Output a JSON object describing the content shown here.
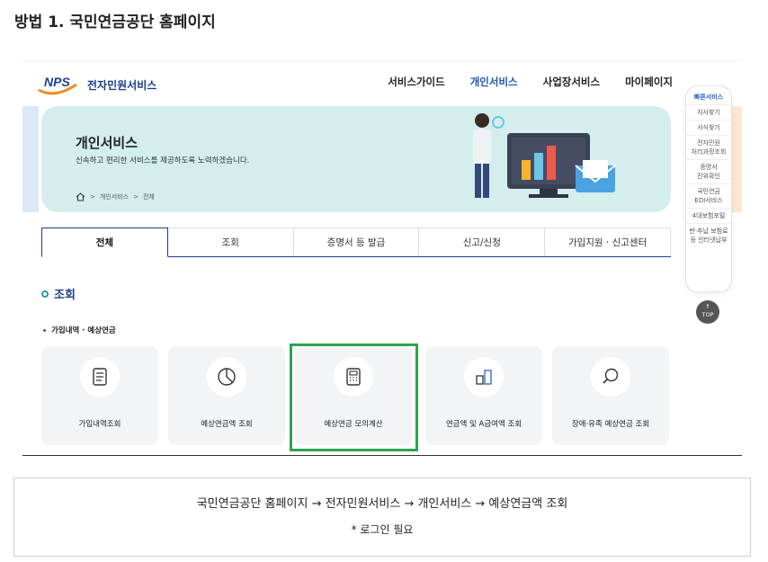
{
  "step_title": "방법 1. 국민연금공단 홈페이지",
  "header": {
    "logo_text": "NPS",
    "service_name": "전자민원서비스",
    "nav": [
      "서비스가이드",
      "개인서비스",
      "사업장서비스",
      "마이페이지"
    ],
    "active_nav": "개인서비스"
  },
  "quick_menu": {
    "items": [
      "빠른서비스",
      "지사찾기",
      "서식찾기",
      "전자민원\n처리과정조회",
      "증명서\n진위확인",
      "국민연금\nEDI서비스",
      "4대보험포털",
      "반·추납 보험료\n등 인터넷납부"
    ],
    "top": "TOP"
  },
  "banner": {
    "title": "개인서비스",
    "desc": "신속하고 편리한 서비스를 제공하도록 노력하겠습니다.",
    "crumb": [
      "개인서비스",
      "전체"
    ]
  },
  "tabs": [
    "전체",
    "조회",
    "증명서 등 발급",
    "신고/신청",
    "가입지원 · 신고센터"
  ],
  "active_tab": "전체",
  "section": {
    "title": "조회",
    "subtitle": "가입내역 · 예상연금",
    "cards": [
      {
        "label": "가입내역조회",
        "icon": "document-icon"
      },
      {
        "label": "예상연금액 조회",
        "icon": "pie-chart-icon"
      },
      {
        "label": "예상연금 모의계산",
        "icon": "calculator-icon"
      },
      {
        "label": "연금액 및 A급여액 조회",
        "icon": "bar-compare-icon"
      },
      {
        "label": "장애·유족 예상연금 조회",
        "icon": "magnifier-icon"
      }
    ]
  },
  "caption": {
    "path": "국민연금공단 홈페이지 → 전자민원서비스 → 개인서비스 → 예상연금액 조회",
    "note": "* 로그인 필요"
  },
  "colors": {
    "brand_navy": "#1b3f8f",
    "brand_orange": "#f28a1e",
    "highlight_green": "#2ea44f",
    "banner_bg": "#d4eeee"
  }
}
